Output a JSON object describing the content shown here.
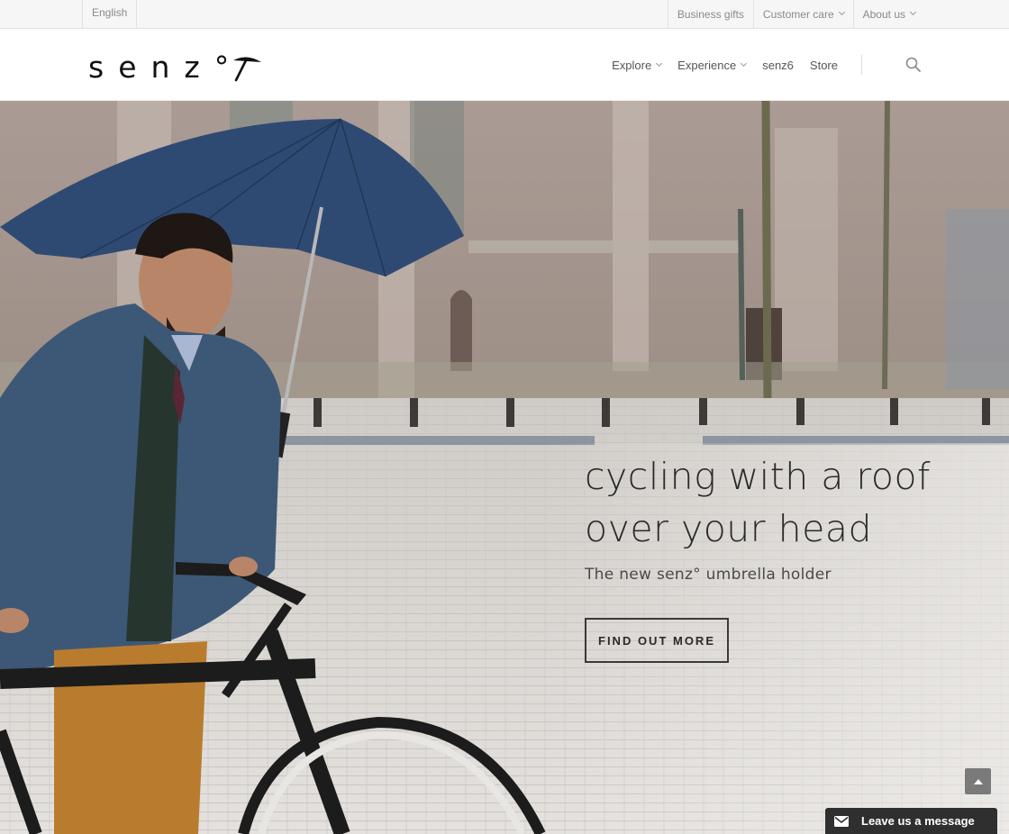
{
  "topbar": {
    "language": "English",
    "links": [
      {
        "label": "Business gifts",
        "dropdown": false
      },
      {
        "label": "Customer care",
        "dropdown": true
      },
      {
        "label": "About us",
        "dropdown": true
      }
    ]
  },
  "header": {
    "logo_text": "senz°",
    "nav": [
      {
        "label": "Explore",
        "dropdown": true
      },
      {
        "label": "Experience",
        "dropdown": true
      },
      {
        "label": "senz6",
        "dropdown": false
      },
      {
        "label": "Store",
        "dropdown": false
      }
    ],
    "search_icon": "search-icon"
  },
  "hero": {
    "title": "cycling with a roof\nover your head",
    "subtitle": "The new senz° umbrella holder",
    "cta_label": "FIND OUT MORE"
  },
  "widgets": {
    "back_to_top_icon": "chevron-up-icon",
    "chat_label": "Leave us a message",
    "chat_icon": "envelope-icon"
  },
  "colors": {
    "umbrella": "#2f4a72",
    "text_dark": "#2a2a2a",
    "chat_bg": "#2f2f2f"
  }
}
